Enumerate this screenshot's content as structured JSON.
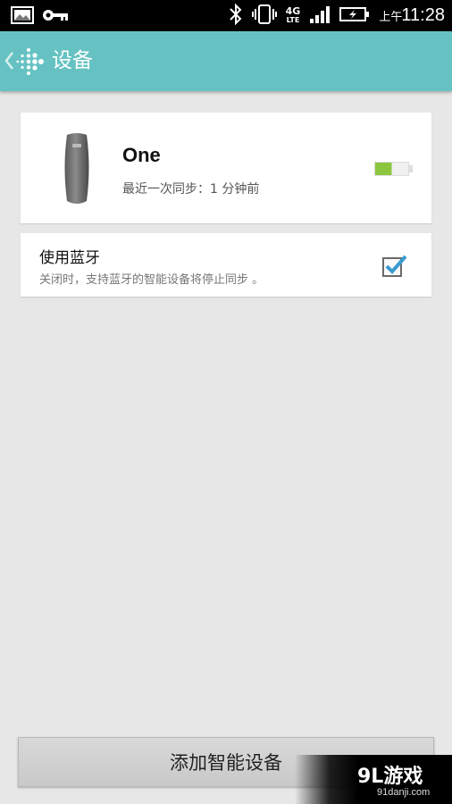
{
  "status_bar": {
    "network_top": "4G",
    "network_bottom": "LTE",
    "ampm": "上午",
    "time": "11:28"
  },
  "app_bar": {
    "title": "设备"
  },
  "device": {
    "name": "One",
    "last_sync": "最近一次同步：1 分钟前",
    "battery_level": 0.5
  },
  "bluetooth": {
    "title": "使用蓝牙",
    "description": "关闭时，支持蓝牙的智能设备将停止同步 。",
    "checked": true
  },
  "add_button": {
    "label": "添加智能设备"
  },
  "watermark": {
    "logo": "9L游戏",
    "url": "91danji.com"
  },
  "colors": {
    "app_bar": "#66c2c2",
    "accent_check": "#3a9bd0",
    "battery_fill": "#8cc63f"
  },
  "icons": [
    "image-icon",
    "key-icon",
    "bluetooth-icon",
    "vibrate-icon",
    "signal-icon",
    "battery-charging-icon",
    "back-chevron-icon",
    "fitbit-logo-icon",
    "battery-icon",
    "checkbox-checked-icon"
  ]
}
